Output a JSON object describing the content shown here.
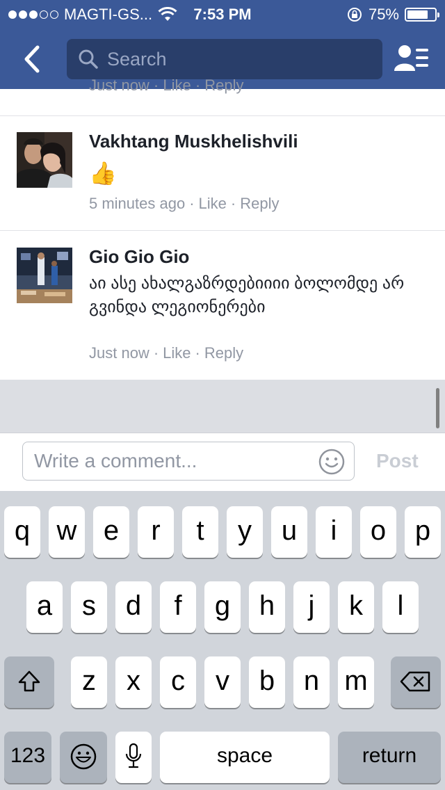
{
  "status_bar": {
    "carrier": "MAGTI-GS...",
    "time": "7:53 PM",
    "battery_percent": "75%",
    "battery_level": 0.75,
    "signal_dots_filled": 3,
    "signal_dots_total": 5
  },
  "nav": {
    "search_placeholder": "Search",
    "accent_color": "#3b5998"
  },
  "comments": [
    {
      "meta_cut": "Just now · Like · Reply"
    },
    {
      "author": "Vakhtang Muskhelishvili",
      "body": "👍",
      "time": "5 minutes ago",
      "like": "Like",
      "reply": "Reply"
    },
    {
      "author": "Gio Gio Gio",
      "body": "აი ასე ახალგაზრდებიიიი ბოლომდე არ გვინდა ლეგიონერები",
      "time": "Just now",
      "like": "Like",
      "reply": "Reply"
    }
  ],
  "composer": {
    "placeholder": "Write a comment...",
    "post_label": "Post"
  },
  "keyboard": {
    "row1": [
      "q",
      "w",
      "e",
      "r",
      "t",
      "y",
      "u",
      "i",
      "o",
      "p"
    ],
    "row2": [
      "a",
      "s",
      "d",
      "f",
      "g",
      "h",
      "j",
      "k",
      "l"
    ],
    "row3": [
      "z",
      "x",
      "c",
      "v",
      "b",
      "n",
      "m"
    ],
    "numbers_label": "123",
    "space_label": "space",
    "return_label": "return"
  },
  "icons": [
    "back-arrow-icon",
    "search-icon",
    "friends-icon",
    "wifi-icon",
    "orientation-lock-icon",
    "battery-icon",
    "thumbs-up-emoji",
    "smiley-icon",
    "shift-icon",
    "delete-icon",
    "emoji-key-icon",
    "microphone-icon"
  ]
}
